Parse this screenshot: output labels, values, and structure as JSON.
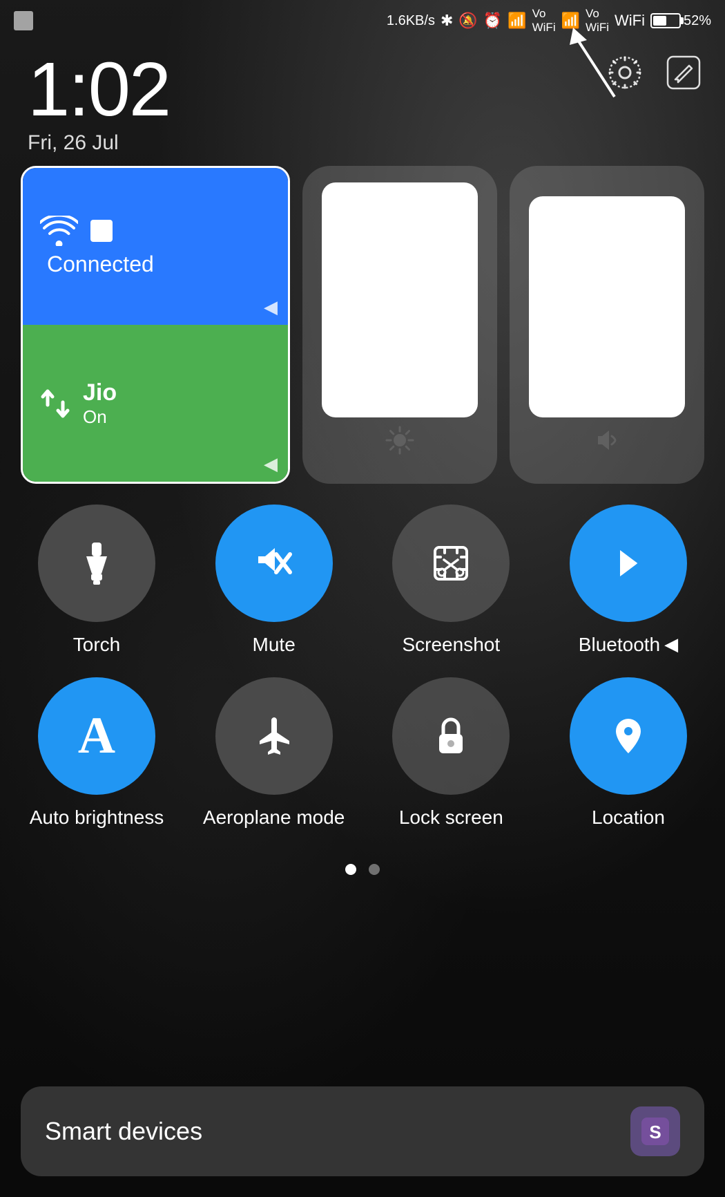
{
  "statusBar": {
    "speed": "1.6KB/s",
    "batteryPercent": "52%",
    "time": "1:02",
    "date": "Fri, 26 Jul"
  },
  "network": {
    "wifiLabel": "Connected",
    "dataName": "Jio",
    "dataStatus": "On"
  },
  "sliders": {
    "brightnessIcon": "☀",
    "volumeIcon": "♪"
  },
  "toggles": {
    "row1": [
      {
        "id": "torch",
        "label": "Torch",
        "state": "off"
      },
      {
        "id": "mute",
        "label": "Mute",
        "state": "on"
      },
      {
        "id": "screenshot",
        "label": "Screenshot",
        "state": "off"
      },
      {
        "id": "bluetooth",
        "label": "Bluetooth",
        "state": "on"
      }
    ],
    "row2": [
      {
        "id": "auto-brightness",
        "label": "Auto brightness",
        "state": "on"
      },
      {
        "id": "aeroplane",
        "label": "Aeroplane mode",
        "state": "off"
      },
      {
        "id": "lock-screen",
        "label": "Lock screen",
        "state": "off"
      },
      {
        "id": "location",
        "label": "Location",
        "state": "on"
      }
    ]
  },
  "pagination": {
    "dots": [
      {
        "active": true
      },
      {
        "active": false
      }
    ]
  },
  "smartDevices": {
    "label": "Smart devices"
  },
  "icons": {
    "gear": "⚙",
    "edit": "✎",
    "smartDeviceIcon": "S"
  }
}
